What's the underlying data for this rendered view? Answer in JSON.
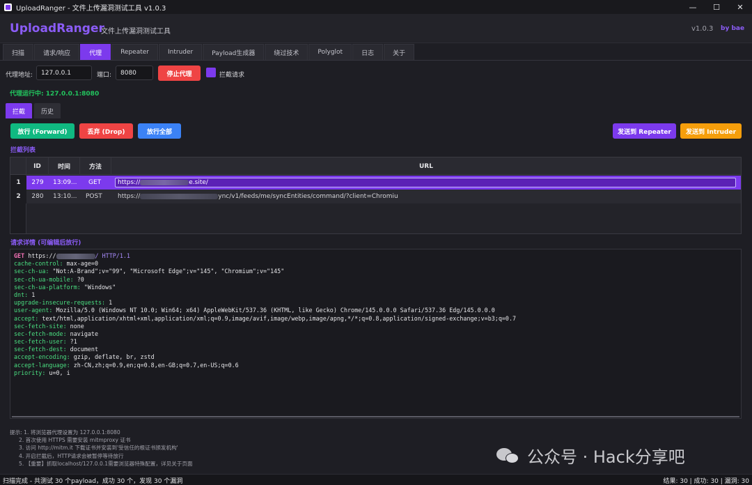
{
  "window": {
    "title": "UploadRanger - 文件上传漏洞测试工具 v1.0.3",
    "minimize": "—",
    "maximize": "☐",
    "close": "✕"
  },
  "header": {
    "brand": "UploadRanger",
    "subtitle": "文件上传漏洞测试工具",
    "version": "v1.0.3",
    "by": "by bae"
  },
  "tabs": [
    "扫描",
    "请求/响应",
    "代理",
    "Repeater",
    "Intruder",
    "Payload生成器",
    "绕过技术",
    "Polyglot",
    "日志",
    "关于"
  ],
  "proxy": {
    "addr_label": "代理地址:",
    "addr_value": "127.0.0.1",
    "port_label": "端口:",
    "port_value": "8080",
    "stop_button": "停止代理",
    "intercept_label": "拦截请求",
    "status": "代理运行中: 127.0.0.1:8080"
  },
  "subtabs": [
    "拦截",
    "历史"
  ],
  "actions": {
    "forward": "放行 (Forward)",
    "drop": "丢弃 (Drop)",
    "forward_all": "放行全部",
    "send_repeater": "发送到 Repeater",
    "send_intruder": "发送到 Intruder"
  },
  "list": {
    "title": "拦截列表",
    "columns": [
      "ID",
      "时间",
      "方法",
      "URL"
    ],
    "rows": [
      {
        "num": "1",
        "id": "279",
        "time": "13:09...",
        "method": "GET",
        "url_prefix": "https://",
        "url_suffix": "e.site/"
      },
      {
        "num": "2",
        "id": "280",
        "time": "13:10...",
        "method": "POST",
        "url_prefix": "https://",
        "url_suffix": "ync/v1/feeds/me/syncEntities/command/?client=Chromiu"
      }
    ]
  },
  "detail": {
    "title": "请求详情 (可编辑后放行)",
    "request_line": {
      "method": "GET",
      "url_prefix": "https://",
      "url_suffix": "/ HTTP/1.1"
    },
    "headers": [
      {
        "k": "cache-control:",
        "v": " max-age=0"
      },
      {
        "k": "sec-ch-ua:",
        "v": " \"Not:A-Brand\";v=\"99\", \"Microsoft Edge\";v=\"145\", \"Chromium\";v=\"145\""
      },
      {
        "k": "sec-ch-ua-mobile:",
        "v": " ?0"
      },
      {
        "k": "sec-ch-ua-platform:",
        "v": " \"Windows\""
      },
      {
        "k": "dnt:",
        "v": " 1"
      },
      {
        "k": "upgrade-insecure-requests:",
        "v": " 1"
      },
      {
        "k": "user-agent:",
        "v": " Mozilla/5.0 (Windows NT 10.0; Win64; x64) AppleWebKit/537.36 (KHTML, like Gecko) Chrome/145.0.0.0 Safari/537.36 Edg/145.0.0.0"
      },
      {
        "k": "accept:",
        "v": " text/html,application/xhtml+xml,application/xml;q=0.9,image/avif,image/webp,image/apng,*/*;q=0.8,application/signed-exchange;v=b3;q=0.7"
      },
      {
        "k": "sec-fetch-site:",
        "v": " none"
      },
      {
        "k": "sec-fetch-mode:",
        "v": " navigate"
      },
      {
        "k": "sec-fetch-user:",
        "v": " ?1"
      },
      {
        "k": "sec-fetch-dest:",
        "v": " document"
      },
      {
        "k": "accept-encoding:",
        "v": " gzip, deflate, br, zstd"
      },
      {
        "k": "accept-language:",
        "v": " zh-CN,zh;q=0.9,en;q=0.8,en-GB;q=0.7,en-US;q=0.6"
      },
      {
        "k": "priority:",
        "v": " u=0, i"
      }
    ]
  },
  "tips": [
    "提示: 1. 将浏览器代理设置为 127.0.0.1:8080",
    "2. 首次使用 HTTPS 需要安装 mitmproxy 证书",
    "3. 访问 http://mitm.it 下载证书并安装到'受信任的根证书颁发机构'",
    "4. 开启拦截后，HTTP请求会被暂停等待放行",
    "5. 【重要】抓取localhost/127.0.0.1需要浏览器特殊配置，详见关于页面"
  ],
  "watermark": "公众号 · Hack分享吧",
  "statusbar": {
    "left": "扫描完成 - 共测试 30 个payload，成功 30 个，发现 30 个漏洞",
    "right": "结果: 30 | 成功: 30 | 漏洞: 30"
  },
  "colors": {
    "accent": "#7c3aed",
    "stop": "#ef4444",
    "forward": "#10b981",
    "drop": "#ef4444",
    "forward_all": "#3b82f6",
    "repeater": "#7c3aed",
    "intruder": "#f59e0b",
    "header_key": "#4ade80"
  }
}
